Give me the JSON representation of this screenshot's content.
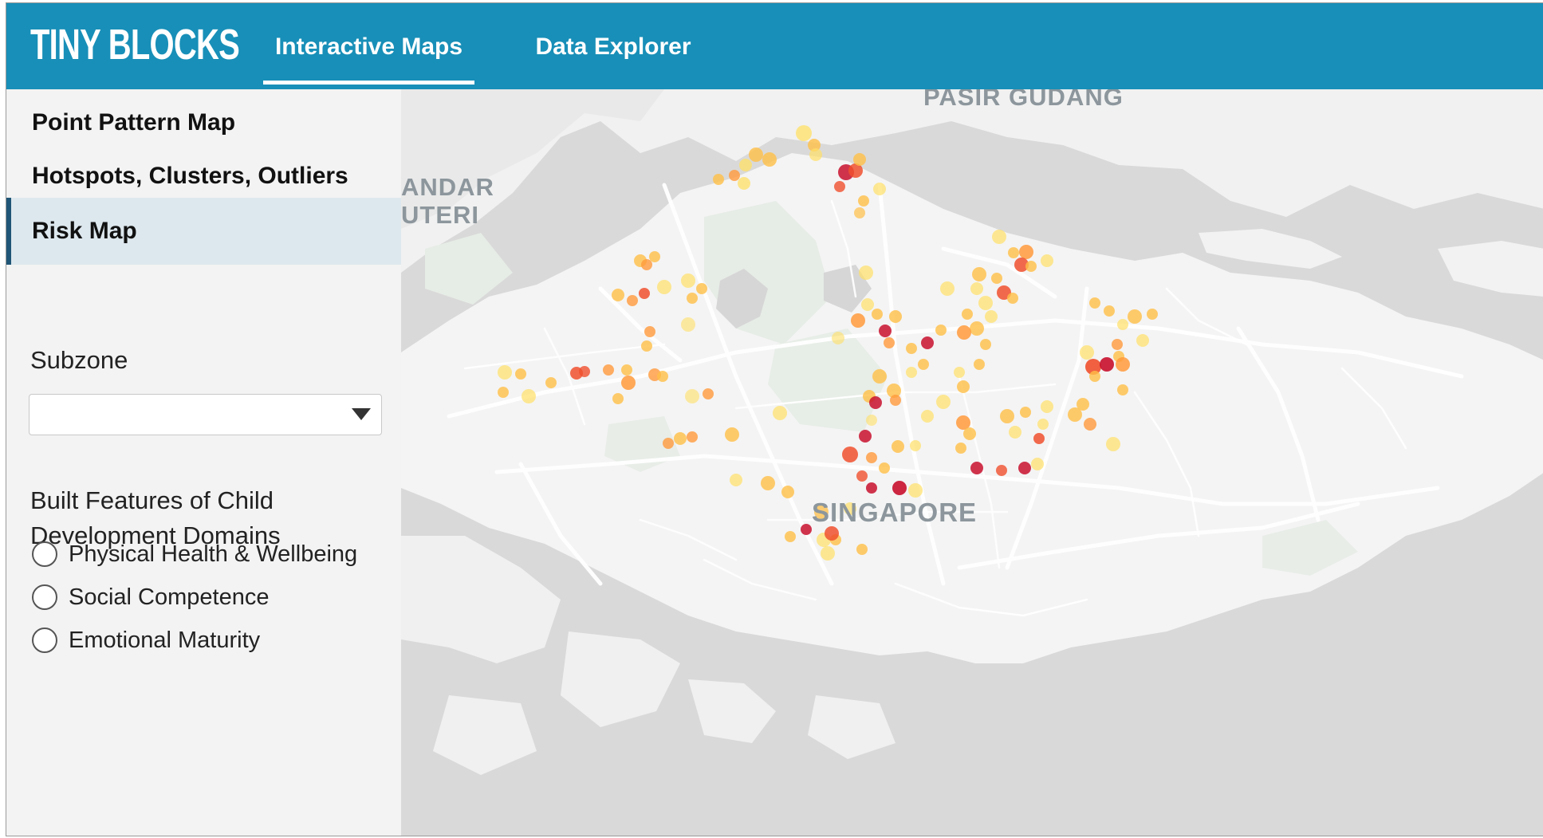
{
  "app": {
    "brand": "TINY BLOCKS",
    "nav_tabs": [
      {
        "label": "Interactive Maps",
        "active": true
      },
      {
        "label": "Data Explorer",
        "active": false
      }
    ]
  },
  "sidebar": {
    "items": [
      {
        "label": "Point Pattern Map",
        "active": false
      },
      {
        "label": "Hotspots, Clusters, Outliers",
        "active": false
      },
      {
        "label": "Risk Map",
        "active": true
      }
    ],
    "subzone": {
      "label": "Subzone",
      "selected": ""
    },
    "domains": {
      "label": "Built Features of Child Development Domains",
      "options": [
        {
          "label": "Physical Health & Wellbeing",
          "checked": false
        },
        {
          "label": "Social Competence",
          "checked": false
        },
        {
          "label": "Emotional Maturity",
          "checked": false
        }
      ]
    }
  },
  "map": {
    "labels": {
      "pasir_gudang": "PASIR GUDANG",
      "bandar_line1": "ANDAR",
      "bandar_line2": "UTERI",
      "singapore": "SINGAPORE"
    },
    "risk_colors": {
      "low": "#ffe066",
      "mid_low": "#ffbf47",
      "mid": "#ff9a3c",
      "high": "#f0502e",
      "very_high": "#c8102e"
    },
    "accent": "#188fb8"
  }
}
